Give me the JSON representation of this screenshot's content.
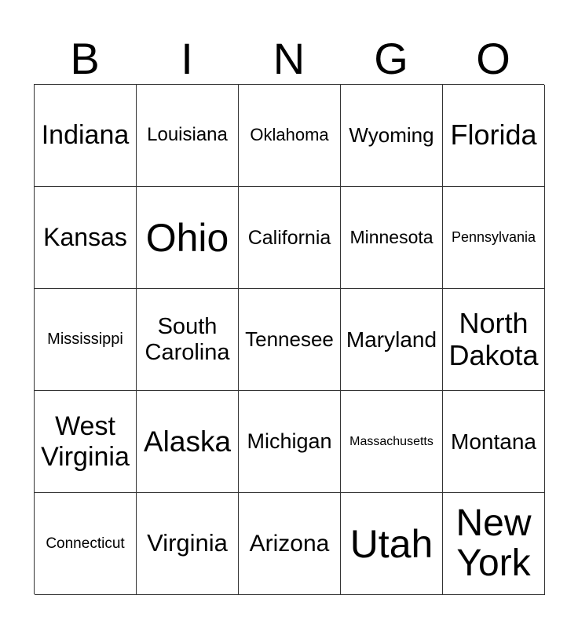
{
  "header": [
    "B",
    "I",
    "N",
    "G",
    "O"
  ],
  "cells": [
    "Indiana",
    "Louisiana",
    "Oklahoma",
    "Wyoming",
    "Florida",
    "Kansas",
    "Ohio",
    "California",
    "Minnesota",
    "Pennsylvania",
    "Mississippi",
    "South Carolina",
    "Tennesee",
    "Maryland",
    "North Dakota",
    "West Virginia",
    "Alaska",
    "Michigan",
    "Massachusetts",
    "Montana",
    "Connecticut",
    "Virginia",
    "Arizona",
    "Utah",
    "New York"
  ]
}
